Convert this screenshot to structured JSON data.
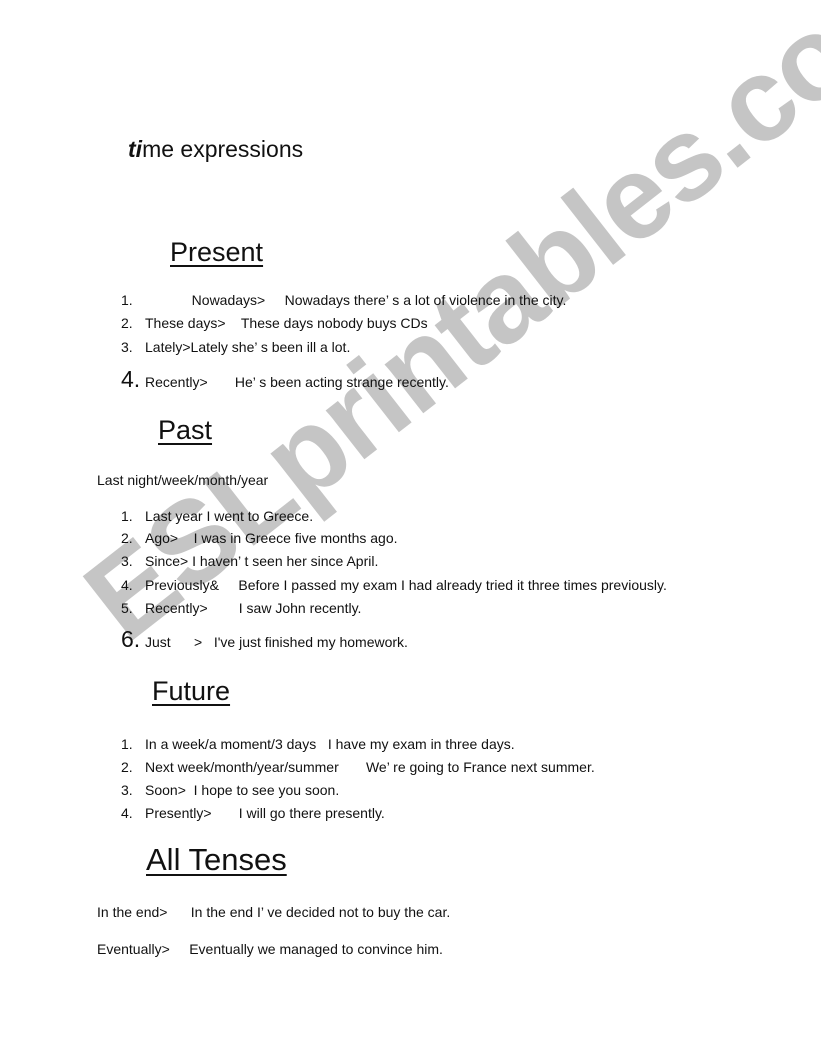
{
  "title": {
    "bold_part": "ti",
    "rest": "me expressions"
  },
  "sections": {
    "present": {
      "heading": "Present",
      "items": [
        {
          "n": "1.",
          "text": "            Nowadays>     Nowadays there’ s a lot of violence in the city."
        },
        {
          "n": "2.",
          "text": "These days>    These days nobody buys CDs"
        },
        {
          "n": "3.",
          "text": "Lately>Lately she’ s been ill a lot."
        },
        {
          "n": "4.",
          "text": "Recently>       He’ s been acting strange recently."
        }
      ]
    },
    "past": {
      "heading": "Past",
      "intro": "Last night/week/month/year",
      "items": [
        {
          "n": "1.",
          "text": "Last year I went to Greece."
        },
        {
          "n": "2.",
          "text": "Ago>    I was in Greece five months ago."
        },
        {
          "n": "3.",
          "text": "Since> I haven’ t seen her since April."
        },
        {
          "n": "4.",
          "text": "Previously&     Before I passed my exam I had already tried it three times previously."
        },
        {
          "n": "5.",
          "text": "Recently>        I saw John recently."
        },
        {
          "n": "6.",
          "text": "Just      >   I've just finished my homework."
        }
      ]
    },
    "future": {
      "heading": "Future",
      "items": [
        {
          "n": "1.",
          "text": "In a week/a moment/3 days   I have my exam in three days."
        },
        {
          "n": "2.",
          "text": "Next week/month/year/summer       We’ re going to France next summer."
        },
        {
          "n": "3.",
          "text": "Soon>  I hope to see you soon."
        },
        {
          "n": "4.",
          "text": "Presently>       I will go there presently."
        }
      ]
    },
    "all_tenses": {
      "heading": "All Tenses",
      "items": [
        {
          "text": "In the end>      In the end I’ ve decided not to buy the car."
        },
        {
          "text": "Eventually>     Eventually we managed to convince him."
        }
      ]
    }
  },
  "watermark": "ESLprintables.com"
}
